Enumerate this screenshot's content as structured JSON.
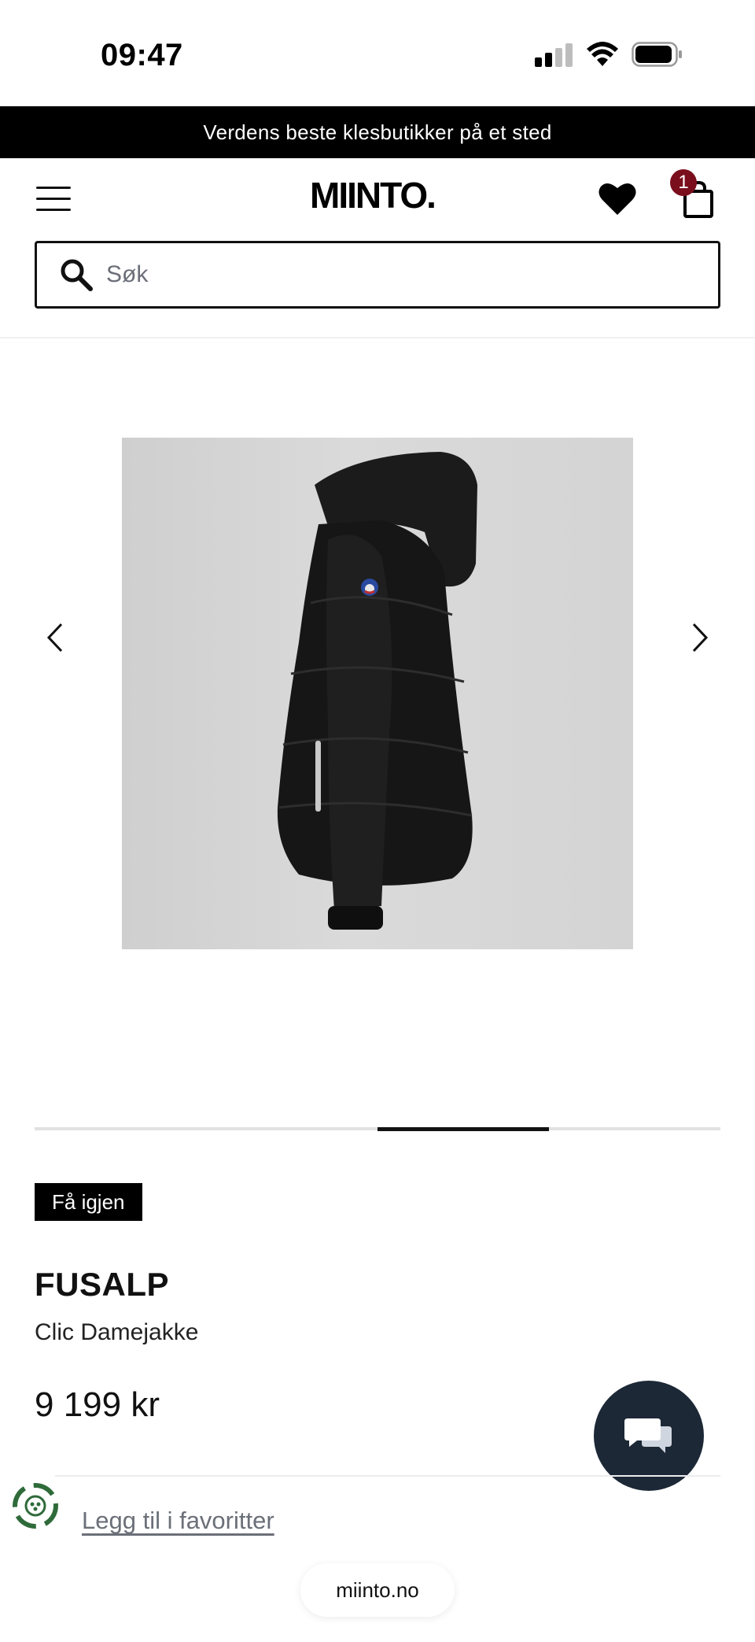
{
  "status_bar": {
    "time": "09:47"
  },
  "promo": {
    "text": "Verdens beste klesbutikker på et sted"
  },
  "header": {
    "logo": "MIINTO.",
    "cart_count": "1",
    "badge_color": "#7a0e1d"
  },
  "search": {
    "placeholder": "Søk"
  },
  "carousel": {
    "progress": {
      "start_fraction": 0.5,
      "end_fraction": 0.75
    }
  },
  "product": {
    "tag": "Få igjen",
    "brand": "FUSALP",
    "name": "Clic Damejakke",
    "price": "9 199 kr"
  },
  "actions": {
    "favorite_label": "Legg til i favoritter"
  },
  "browser": {
    "url": "miinto.no"
  },
  "icons": {
    "menu": "hamburger-menu-icon",
    "wishlist": "heart-icon",
    "cart": "shopping-bag-icon",
    "search": "search-icon",
    "prev": "chevron-left-icon",
    "next": "chevron-right-icon",
    "chat": "chat-bubbles-icon",
    "eco": "recycle-icon"
  },
  "colors": {
    "promo_bg": "#000000",
    "chat_bg": "#1c2836",
    "text_muted": "#6b6f78"
  }
}
